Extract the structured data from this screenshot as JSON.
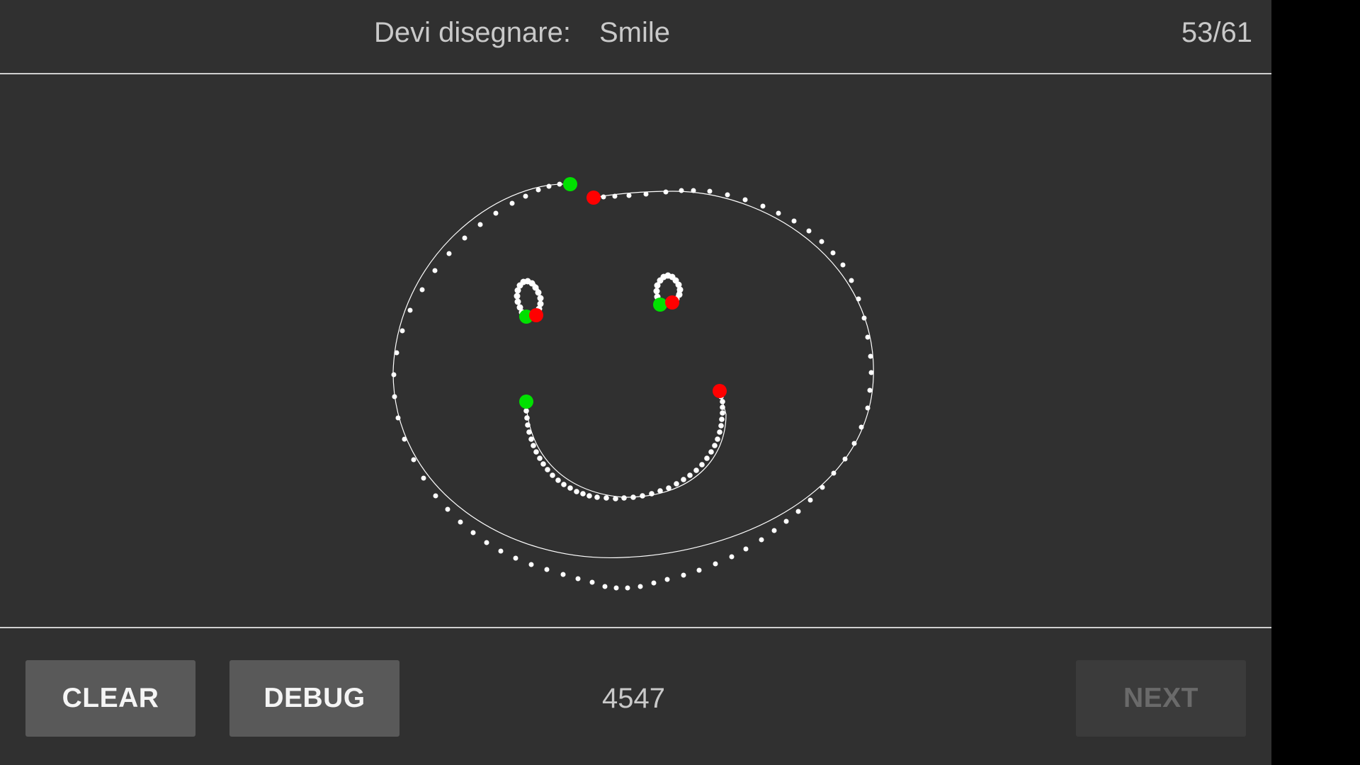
{
  "header": {
    "prompt_label": "Devi disegnare:",
    "prompt_word": "Smile",
    "progress": "53/61"
  },
  "footer": {
    "clear_label": "CLEAR",
    "debug_label": "DEBUG",
    "score": "4547",
    "next_label": "NEXT"
  },
  "colors": {
    "background": "#303030",
    "stroke_point": "#ffffff",
    "stroke_start": "#00e000",
    "stroke_end": "#ff0000",
    "button": "#595959",
    "button_disabled": "#3b3b3b"
  }
}
